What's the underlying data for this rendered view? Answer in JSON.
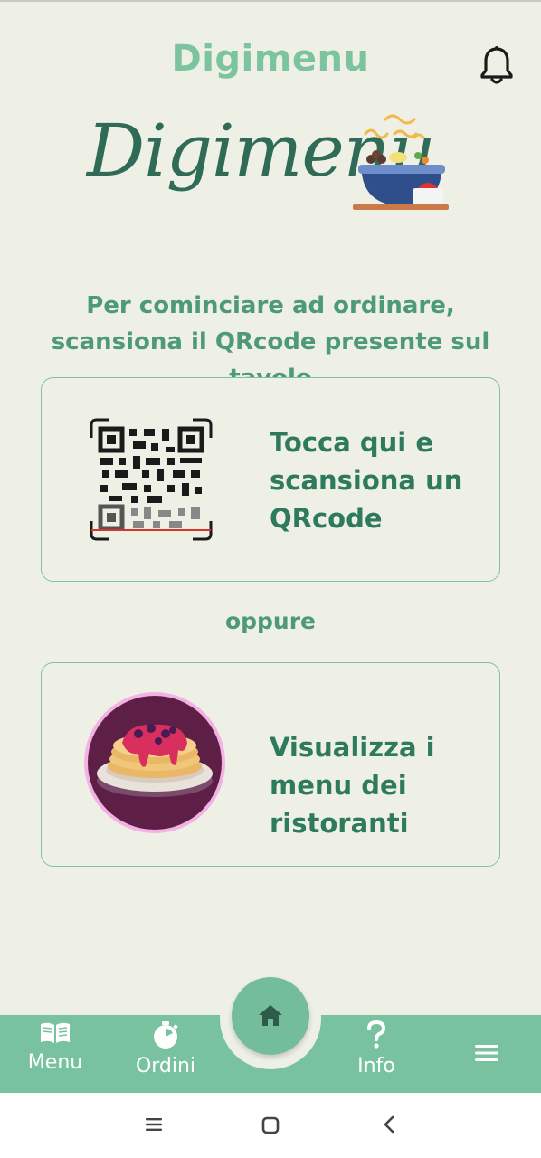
{
  "header": {
    "title": "Digimenu",
    "logo_text": "Digimenu"
  },
  "intro": {
    "text": "Per cominciare ad ordinare, scansiona il QRcode presente sul tavolo"
  },
  "qr_card": {
    "label": "Tocca qui e scansiona un QRcode"
  },
  "separator": {
    "text": "oppure"
  },
  "menu_card": {
    "label": "Visualizza i menu dei ristoranti"
  },
  "bottom_nav": {
    "menu": "Menu",
    "ordini": "Ordini",
    "info": "Info"
  },
  "colors": {
    "background": "#eef0e6",
    "accent": "#7cc3a0",
    "dark_green": "#2e7a5c",
    "navbar": "#79c2a0"
  },
  "icons": [
    "bell-icon",
    "qr-code-icon",
    "pancake-icon",
    "book-icon",
    "stopwatch-icon",
    "question-icon",
    "hamburger-icon",
    "home-icon"
  ]
}
